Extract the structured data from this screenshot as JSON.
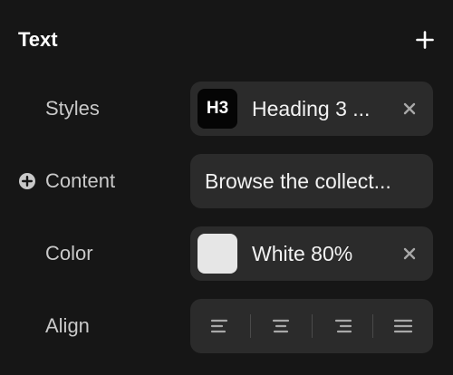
{
  "section": {
    "title": "Text",
    "add_icon": "plus-icon"
  },
  "rows": {
    "styles": {
      "label": "Styles",
      "badge": "H3",
      "value": "Heading 3 ...",
      "clear_icon": "close-icon"
    },
    "content": {
      "label": "Content",
      "icon": "plus-circle-icon",
      "value": "Browse the collect..."
    },
    "color": {
      "label": "Color",
      "swatch_color": "#e6e6e6",
      "value": "White 80%",
      "clear_icon": "close-icon"
    },
    "align": {
      "label": "Align",
      "options": [
        "align-left-icon",
        "align-center-icon",
        "align-right-icon",
        "align-justify-icon"
      ]
    }
  },
  "colors": {
    "background": "#161616",
    "control_bg": "#2b2b2b",
    "label_text": "#c9c9c9",
    "value_text": "#f2f2f2"
  }
}
